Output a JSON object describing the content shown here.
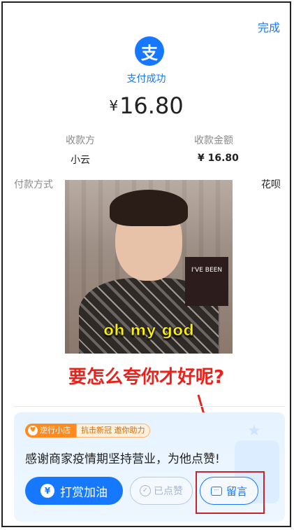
{
  "header": {
    "done_label": "完成"
  },
  "payment": {
    "logo_glyph": "支",
    "status": "支付成功",
    "currency": "¥",
    "amount": "16.80"
  },
  "details": {
    "payee_label": "收款方",
    "payee_value": "小云",
    "amount_label": "收款金额",
    "amount_value": "¥ 16.80",
    "method_label": "付款方式",
    "method_value": "花呗"
  },
  "ad_image": {
    "caption": "oh my god",
    "book_text": "I'VE BEEN"
  },
  "overlay_text": "要怎么夸你才好呢?",
  "card": {
    "tag_primary": "逆行小店",
    "tag_secondary": "抗击新冠 邀你助力",
    "message": "感谢商家疫情期坚持营业，为他点赞!",
    "tip_button": "打赏加油",
    "tip_icon_glyph": "¥",
    "liked_button": "已点赞",
    "message_button": "留言"
  },
  "colors": {
    "accent": "#1677ff",
    "highlight": "#e8231b",
    "tag_orange": "#ff8a1f"
  }
}
